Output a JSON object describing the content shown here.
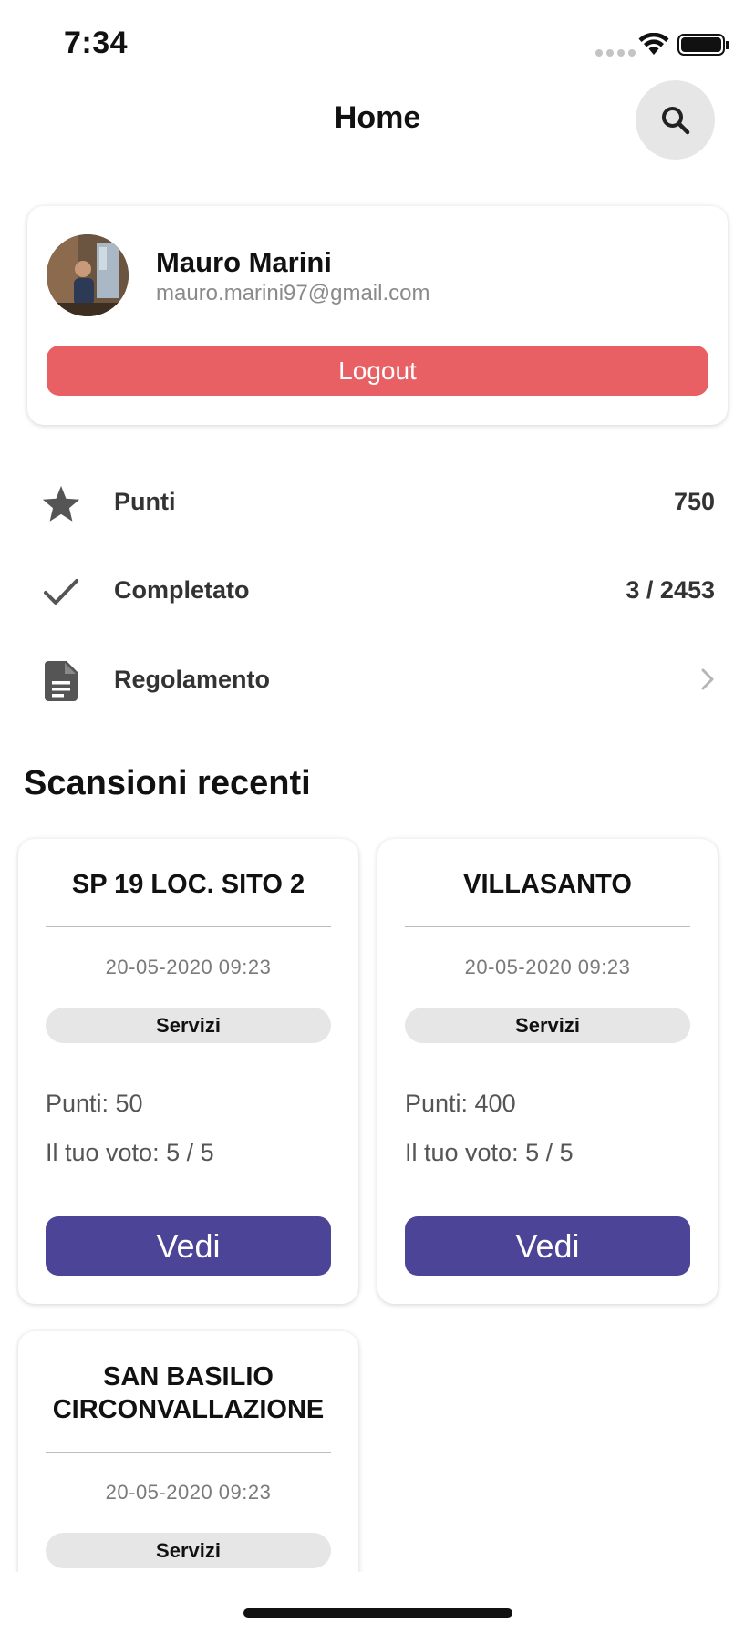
{
  "status_bar": {
    "time": "7:34"
  },
  "nav": {
    "title": "Home",
    "search_icon": "search-icon"
  },
  "profile": {
    "name": "Mauro Marini",
    "email": "mauro.marini97@gmail.com",
    "logout_label": "Logout",
    "logout_color": "#e96064"
  },
  "stats": [
    {
      "icon": "star-icon",
      "label": "Punti",
      "value": "750"
    },
    {
      "icon": "checkmark-icon",
      "label": "Completato",
      "value": "3 / 2453"
    },
    {
      "icon": "document-icon",
      "label": "Regolamento",
      "value": ""
    }
  ],
  "recent": {
    "title": "Scansioni recenti",
    "cards": [
      {
        "title": "SP 19 LOC. SITO 2",
        "date": "20-05-2020 09:23",
        "badge": "Servizi",
        "points": "Punti: 50",
        "vote": "Il tuo voto: 5 / 5",
        "button": "Vedi"
      },
      {
        "title": "VILLASANTO",
        "date": "20-05-2020 09:23",
        "badge": "Servizi",
        "points": "Punti: 400",
        "vote": "Il tuo voto: 5 / 5",
        "button": "Vedi"
      },
      {
        "title": "SAN BASILIO CIRCONVALLAZIONE",
        "date": "20-05-2020 09:23",
        "badge": "Servizi"
      }
    ]
  },
  "colors": {
    "accent": "#4c4497",
    "danger": "#e96064"
  }
}
